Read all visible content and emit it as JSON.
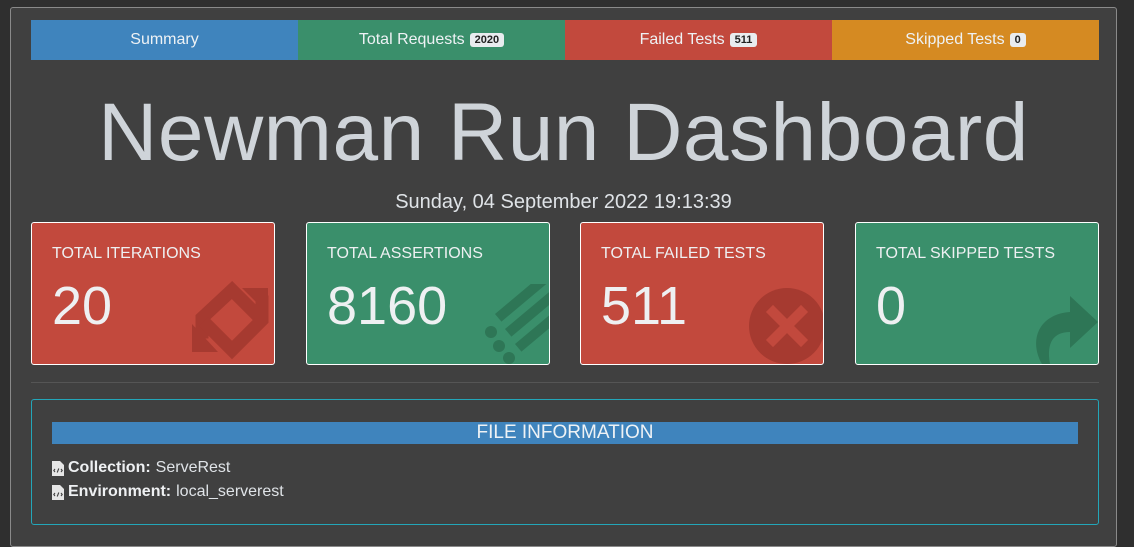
{
  "tabs": [
    {
      "label": "Summary"
    },
    {
      "label": "Total Requests",
      "badge": "2020"
    },
    {
      "label": "Failed Tests",
      "badge": "511"
    },
    {
      "label": "Skipped Tests",
      "badge": "0"
    }
  ],
  "title": "Newman Run Dashboard",
  "date": "Sunday, 04 September 2022 19:13:39",
  "cards": [
    {
      "label": "TOTAL ITERATIONS",
      "value": "20",
      "icon": "sync-icon"
    },
    {
      "label": "TOTAL ASSERTIONS",
      "value": "8160",
      "icon": "tasks-icon"
    },
    {
      "label": "TOTAL FAILED TESTS",
      "value": "511",
      "icon": "times-circle-icon"
    },
    {
      "label": "TOTAL SKIPPED TESTS",
      "value": "0",
      "icon": "share-arrow-icon"
    }
  ],
  "file_info": {
    "heading": "FILE INFORMATION",
    "collection_label": "Collection:",
    "collection_value": "ServeRest",
    "environment_label": "Environment:",
    "environment_value": "local_serverest"
  },
  "colors": {
    "blue": "#3f84bd",
    "green": "#3a8f6b",
    "red": "#c2493d",
    "orange": "#d58a22",
    "teal_border": "#23a6b9"
  }
}
